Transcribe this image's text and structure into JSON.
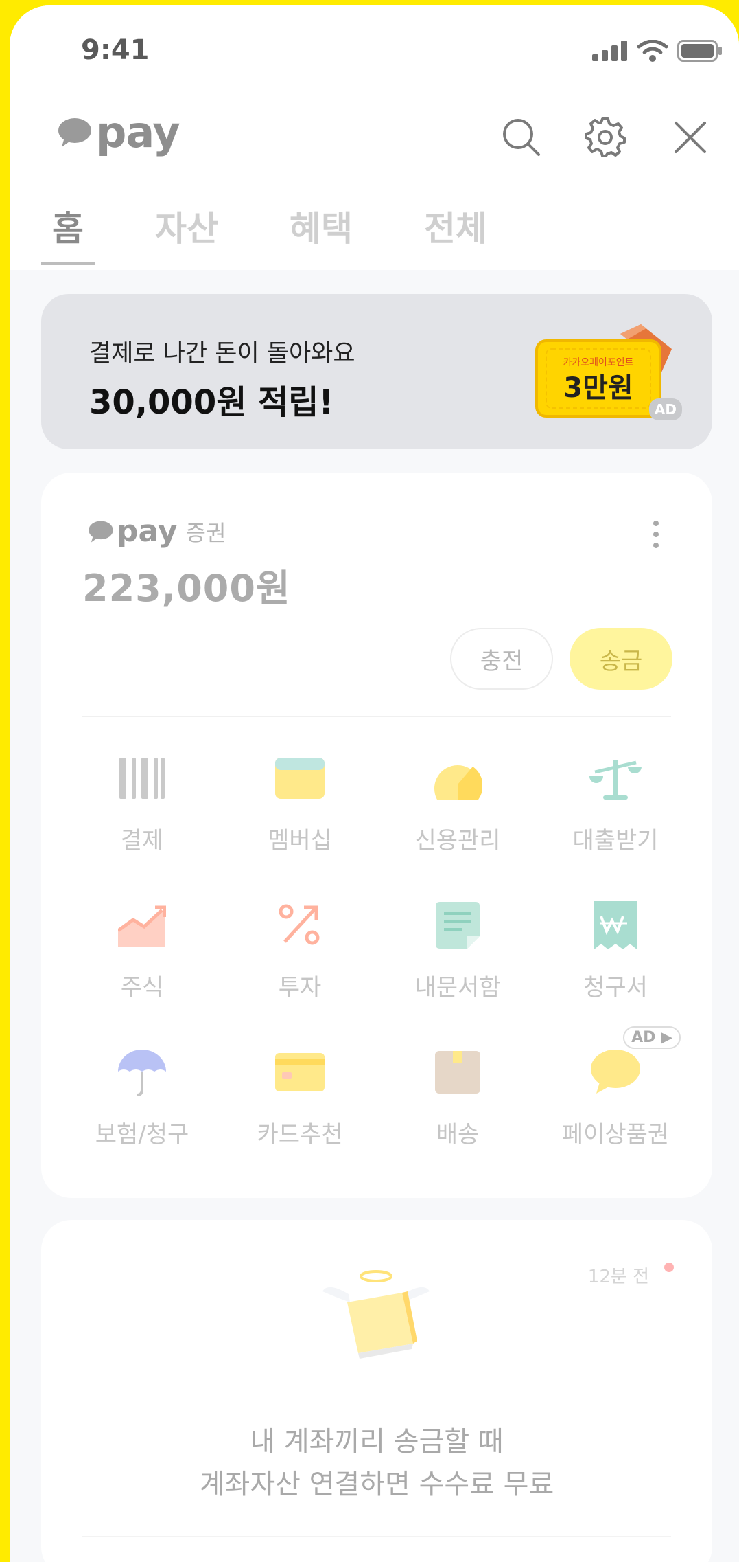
{
  "status": {
    "time": "9:41"
  },
  "header": {
    "logo_text": "pay"
  },
  "tabs": [
    {
      "label": "홈",
      "active": true
    },
    {
      "label": "자산",
      "active": false
    },
    {
      "label": "혜택",
      "active": false
    },
    {
      "label": "전체",
      "active": false
    }
  ],
  "banner": {
    "subtitle": "결제로 나간 돈이 돌아와요",
    "title": "30,000원 적립!",
    "art_small": "카카오페이포인트",
    "art_big": "3만원",
    "ad_label": "AD"
  },
  "account": {
    "brand": "pay",
    "brand_sub": "증권",
    "balance": "223,000원",
    "charge_label": "충전",
    "send_label": "송금"
  },
  "services": [
    {
      "label": "결제",
      "icon": "barcode-icon"
    },
    {
      "label": "멤버십",
      "icon": "wallet-icon"
    },
    {
      "label": "신용관리",
      "icon": "credit-gauge-icon"
    },
    {
      "label": "대출받기",
      "icon": "scale-icon"
    },
    {
      "label": "주식",
      "icon": "stock-chart-icon"
    },
    {
      "label": "투자",
      "icon": "percent-arrow-icon"
    },
    {
      "label": "내문서함",
      "icon": "document-icon"
    },
    {
      "label": "청구서",
      "icon": "bill-icon"
    },
    {
      "label": "보험/청구",
      "icon": "umbrella-icon"
    },
    {
      "label": "카드추천",
      "icon": "card-icon"
    },
    {
      "label": "배송",
      "icon": "box-icon"
    },
    {
      "label": "페이상품권",
      "icon": "chat-bubble-icon"
    }
  ],
  "services_ad_label": "AD",
  "notice": {
    "time": "12분 전",
    "line1": "내 계좌끼리 송금할 때",
    "line2": "계좌자산 연결하면 수수료 무료"
  },
  "colors": {
    "background": "#FFEB00",
    "accent_yellow": "#FFF59D",
    "banner_bg": "#E3E4E8"
  }
}
